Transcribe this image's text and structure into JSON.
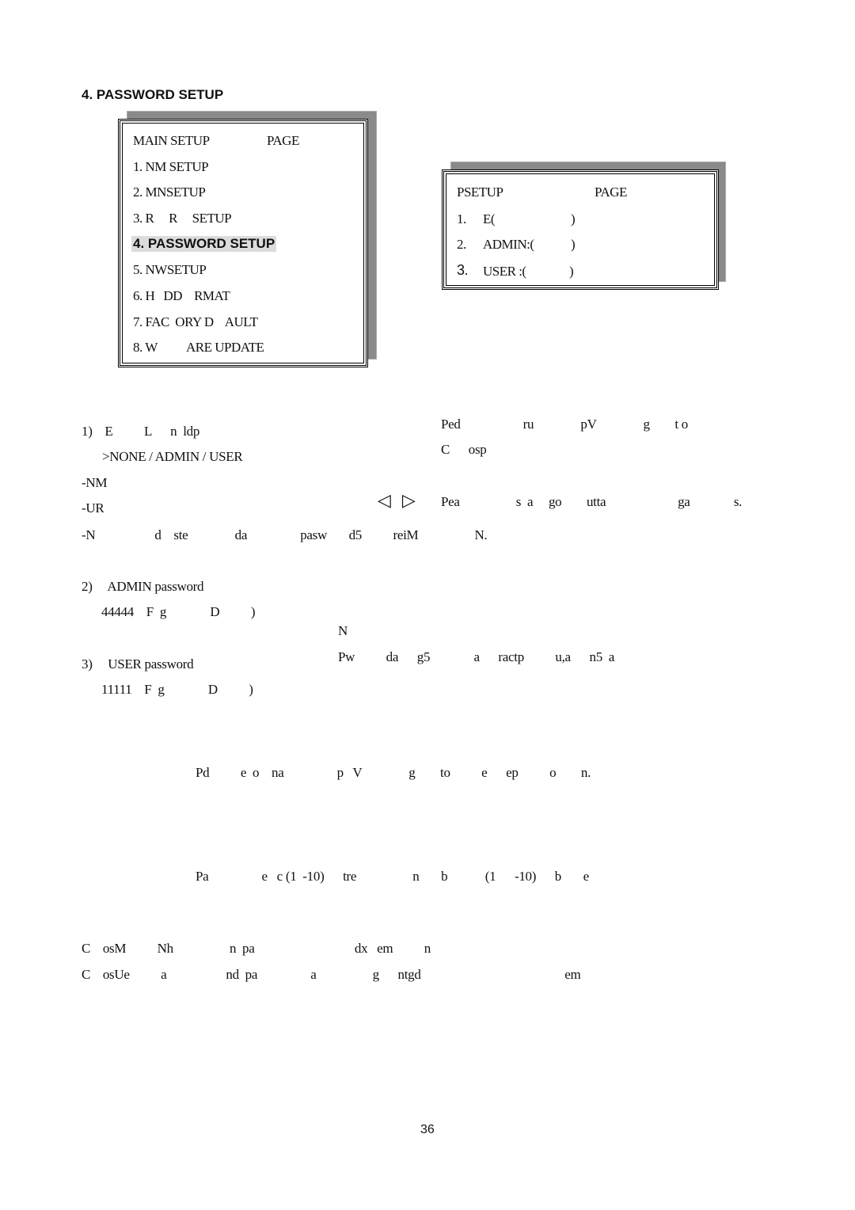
{
  "section_title": "4. PASSWORD SETUP",
  "main_menu": {
    "header_left": "MAIN SETUP",
    "header_right": "PAGE",
    "items": [
      "1. NM SETUP",
      "2. MNSETUP",
      "3. R     R     SETUP",
      "4. PASSWORD SETUP",
      "5. NWSETUP",
      "6. H   DD    RMAT",
      "7. FAC  ORY D    AULT",
      "8. W          ARE UPDATE"
    ],
    "selected_index": 3
  },
  "password_menu": {
    "header_left": "PSETUP",
    "header_right": "PAGE",
    "items": [
      {
        "num": "1.",
        "label": "E(",
        "close": ")"
      },
      {
        "num": "2.",
        "label": "ADMIN:(",
        "close": ")"
      },
      {
        "num": "3.",
        "label": "USER :(",
        "close": ")"
      }
    ]
  },
  "left_text": {
    "item1": "1)    E          L      n  ldp",
    "item1_options": ">NONE / ADMIN / USER",
    "opt_none": "-NM",
    "opt_user": "-UR",
    "opt_note": "-N                   d    ste               da                 pasw       d5          reiM                  N.",
    "item2": "2)     ADMIN password",
    "item2_default": "44444    F  g              D          )",
    "item3": "3)     USER password",
    "item3_default": "11111    F  g              D          )"
  },
  "right_text": {
    "line1": "Ped                    ru               pV               g        t o",
    "line2": "C      osp",
    "arrows": "◁  ▷",
    "line3": "Pea                  s  a     go        utta                       ga              s.",
    "note_label": "N",
    "note_text": "Pw          da      g5              a      ractp          u,a      n5  a"
  },
  "bottom_text": {
    "line1": "Pd          e  o    na                 p   V               g        to          e      ep          o        n.",
    "line2": "Pa                 e   c (1  -10)      tre                  n       b            (1      -10)      b       e",
    "line3": "C    osM          Nh                  n  pa                                dx   em          n",
    "line4": "C    osUe          a                   nd  pa                 a                  g      ntgd                                              em"
  },
  "page_number": "36"
}
